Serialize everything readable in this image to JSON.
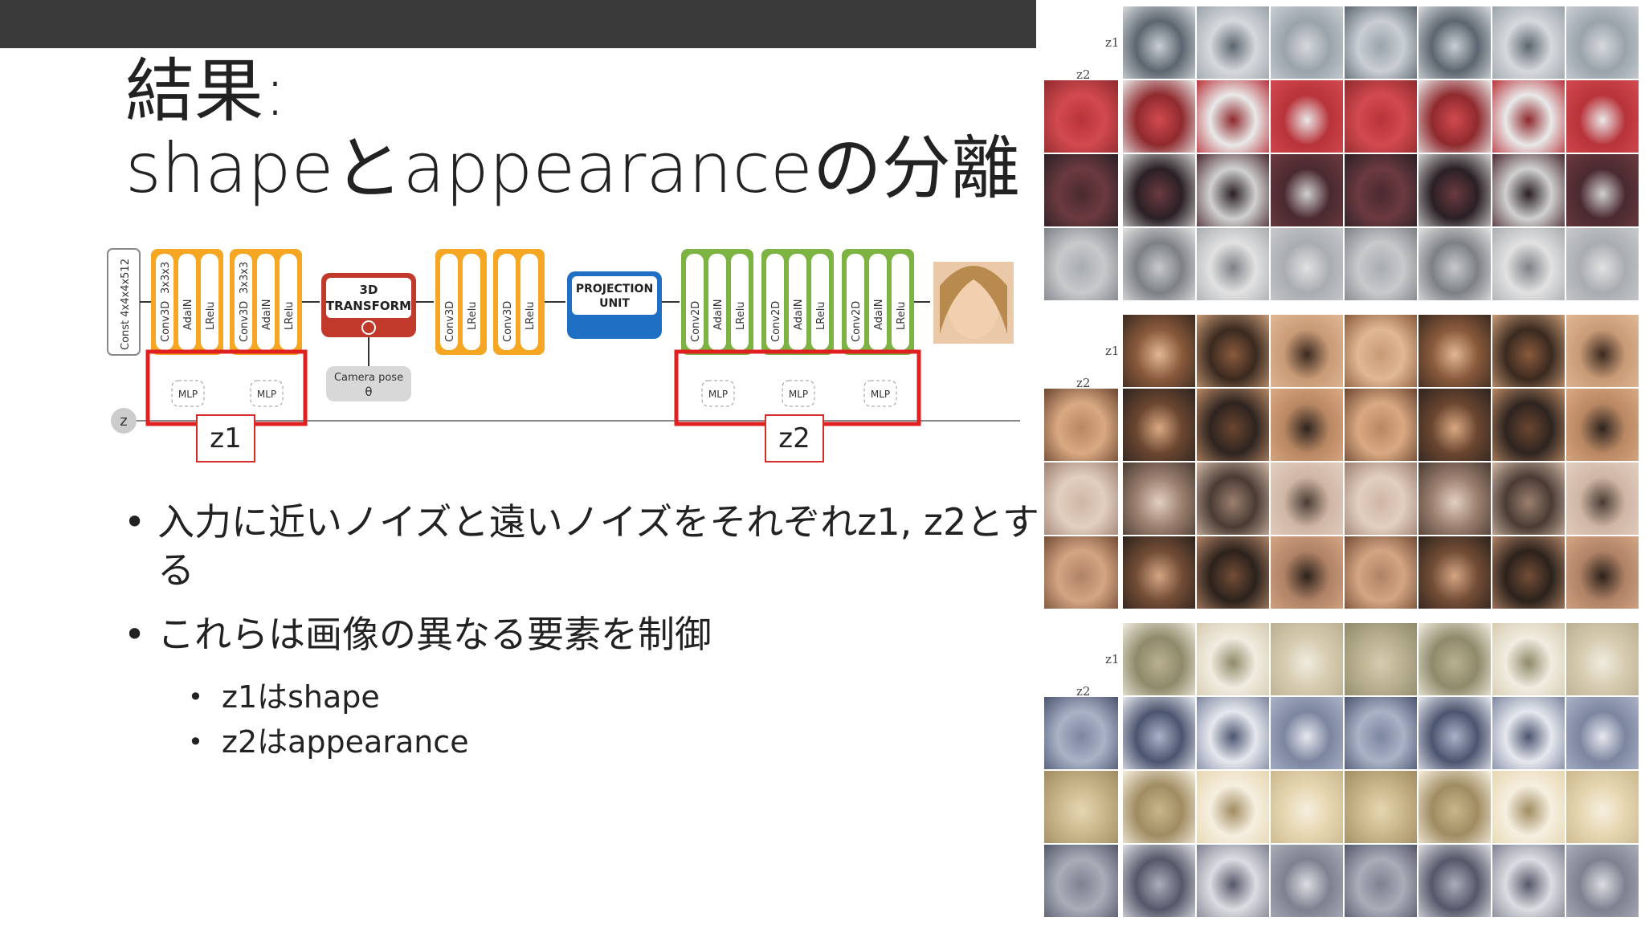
{
  "slide": {
    "title_line1": "結果:",
    "title_line2": "shapeとappearanceの分離"
  },
  "diagram": {
    "const_label": "Const 4x4x4x512",
    "conv3d_label": "Conv3D",
    "kernel_label": "3x3x3",
    "adain_label": "AdaIN",
    "lrelu_label": "LRelu",
    "conv2d_label": "Conv2D",
    "transform_label_1": "3D",
    "transform_label_2": "TRANSFORM",
    "projection_label_1": "PROJECTION",
    "projection_label_2": "UNIT",
    "camera_label_1": "Camera pose",
    "camera_label_2": "θ",
    "mlp_label": "MLP",
    "z_label": "z",
    "z1_label": "z1",
    "z2_label": "z2"
  },
  "bullets": {
    "item1": "入力に近いノイズと遠いノイズをそれぞれz1, z2とする",
    "item2": "これらは画像の異なる要素を制御",
    "sub1": "z1はshape",
    "sub2": "z2はappearance"
  },
  "grid_labels": {
    "z1": "z1",
    "z2": "z2"
  },
  "colors": {
    "orange": "#f5a623",
    "green": "#7cb342",
    "red": "#c0392b",
    "blue": "#1f6fc4",
    "highlight": "#e02020"
  }
}
